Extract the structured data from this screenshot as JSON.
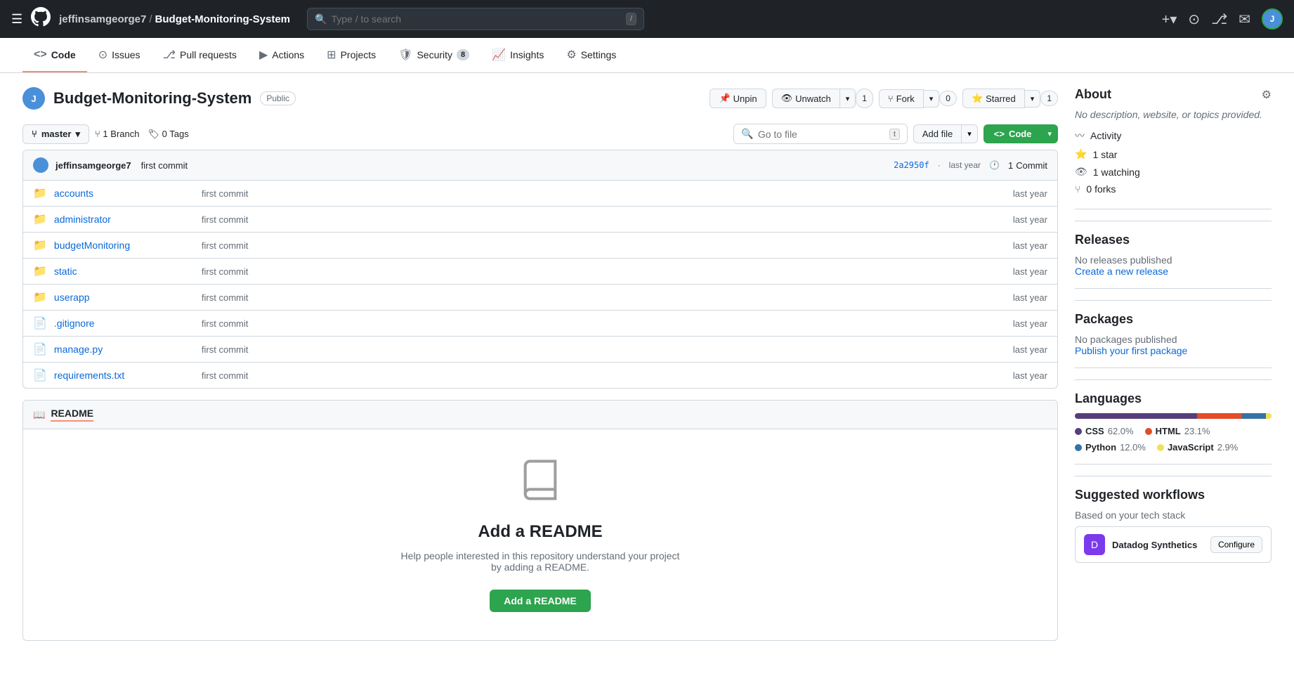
{
  "topnav": {
    "username": "jeffinsamgeorge7",
    "repo": "Budget-Monitoring-System",
    "search_placeholder": "Type / to search",
    "search_shortcut": "/"
  },
  "repotabs": [
    {
      "id": "code",
      "label": "Code",
      "icon": "code",
      "active": true,
      "badge": null
    },
    {
      "id": "issues",
      "label": "Issues",
      "icon": "issue",
      "active": false,
      "badge": null
    },
    {
      "id": "pull-requests",
      "label": "Pull requests",
      "icon": "pr",
      "active": false,
      "badge": null
    },
    {
      "id": "actions",
      "label": "Actions",
      "icon": "play",
      "active": false,
      "badge": null
    },
    {
      "id": "projects",
      "label": "Projects",
      "icon": "table",
      "active": false,
      "badge": null
    },
    {
      "id": "security",
      "label": "Security",
      "icon": "shield",
      "active": false,
      "badge": "8"
    },
    {
      "id": "insights",
      "label": "Insights",
      "icon": "graph",
      "active": false,
      "badge": null
    },
    {
      "id": "settings",
      "label": "Settings",
      "icon": "gear",
      "active": false,
      "badge": null
    }
  ],
  "repoheader": {
    "title": "Budget-Monitoring-System",
    "visibility": "Public",
    "actions": {
      "unpin": "Unpin",
      "watch": "Watch",
      "watch_count": "1",
      "fork": "Fork",
      "fork_count": "0",
      "star": "Star",
      "starred": "Starred",
      "star_count": "1"
    }
  },
  "filebrowser": {
    "branch": "master",
    "branch_count": "1",
    "branch_label": "Branch",
    "tag_count": "0",
    "tag_label": "Tags",
    "search_placeholder": "Go to file",
    "search_shortcut": "t",
    "add_file": "Add file",
    "code_btn": "Code",
    "commit_hash": "2a2950f",
    "commit_time": "last year",
    "commit_count": "1",
    "commit_label": "Commit",
    "commit_author": "jeffinsamgeorge7",
    "commit_message": "first commit"
  },
  "files": [
    {
      "name": "accounts",
      "type": "folder",
      "commit": "first commit",
      "time": "last year"
    },
    {
      "name": "administrator",
      "type": "folder",
      "commit": "first commit",
      "time": "last year"
    },
    {
      "name": "budgetMonitoring",
      "type": "folder",
      "commit": "first commit",
      "time": "last year"
    },
    {
      "name": "static",
      "type": "folder",
      "commit": "first commit",
      "time": "last year"
    },
    {
      "name": "userapp",
      "type": "folder",
      "commit": "first commit",
      "time": "last year"
    },
    {
      "name": ".gitignore",
      "type": "file",
      "commit": "first commit",
      "time": "last year"
    },
    {
      "name": "manage.py",
      "type": "file",
      "commit": "first commit",
      "time": "last year"
    },
    {
      "name": "requirements.txt",
      "type": "file",
      "commit": "first commit",
      "time": "last year"
    }
  ],
  "readme": {
    "title": "README",
    "add_title": "Add a README",
    "desc": "Help people interested in this repository understand your project by adding a README.",
    "add_btn": "Add a README"
  },
  "about": {
    "title": "About",
    "desc": "No description, website, or topics provided.",
    "activity_label": "Activity",
    "star_count": "1",
    "star_label": "star",
    "watching_count": "1",
    "watching_label": "watching",
    "fork_count": "0",
    "fork_label": "forks"
  },
  "releases": {
    "title": "Releases",
    "no_releases": "No releases published",
    "create_link": "Create a new release"
  },
  "packages": {
    "title": "Packages",
    "no_packages": "No packages published",
    "publish_link": "Publish your first package"
  },
  "languages": {
    "title": "Languages",
    "items": [
      {
        "name": "CSS",
        "percent": "62.0",
        "color": "#563d7c"
      },
      {
        "name": "HTML",
        "percent": "23.1",
        "color": "#e34c26"
      },
      {
        "name": "Python",
        "percent": "12.0",
        "color": "#3572A5"
      },
      {
        "name": "JavaScript",
        "percent": "2.9",
        "color": "#f1e05a"
      }
    ]
  },
  "workflows": {
    "title": "Suggested workflows",
    "subtitle": "Based on your tech stack",
    "items": [
      {
        "name": "Datadog Synthetics",
        "icon": "D",
        "color": "#7c3aed",
        "configure": "Configure"
      }
    ]
  }
}
